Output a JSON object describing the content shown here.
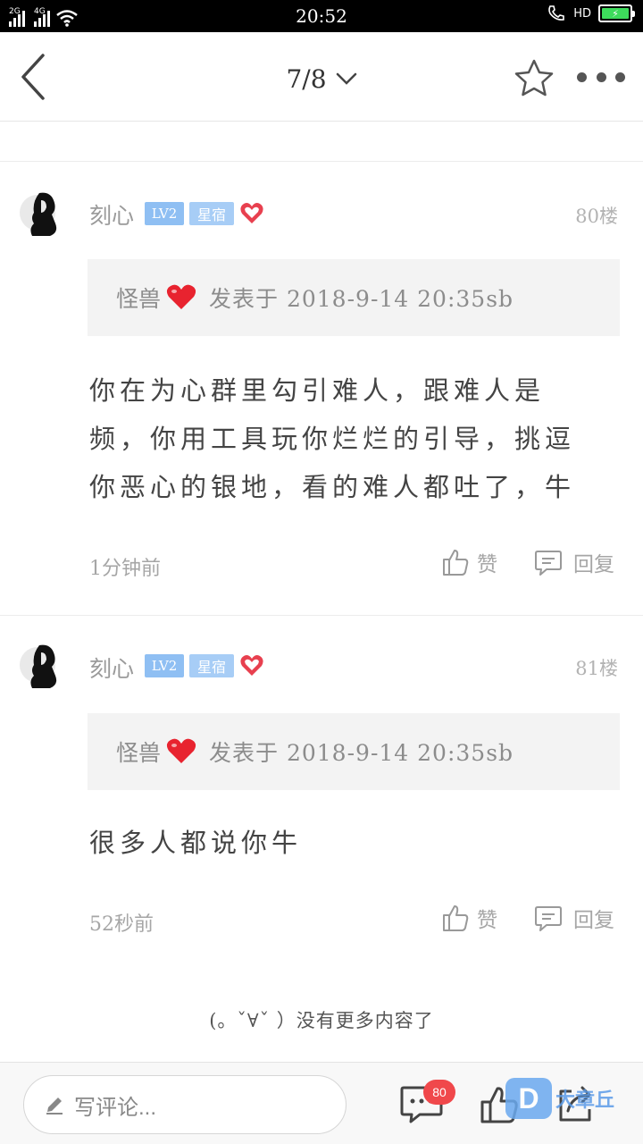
{
  "status_bar": {
    "network_1": "2G",
    "network_2": "4G",
    "time": "20:52",
    "hd": "HD",
    "battery_level": 1.0
  },
  "nav": {
    "page_indicator": "7/8"
  },
  "comments": [
    {
      "username": "刻心",
      "level": "LV2",
      "title": "星宿",
      "floor": "80楼",
      "quote_author": "怪兽",
      "quote_meta": "发表于 2018-9-14 20:35sb",
      "body": "你在为心群里勾引难人，跟难人是频，你用工具玩你烂烂的引导，挑逗你恶心的银地，看的难人都吐了，牛",
      "time_ago": "1分钟前",
      "like_label": "赞",
      "reply_label": "回复"
    },
    {
      "username": "刻心",
      "level": "LV2",
      "title": "星宿",
      "floor": "81楼",
      "quote_author": "怪兽",
      "quote_meta": "发表于 2018-9-14 20:35sb",
      "body": "很多人都说你牛",
      "time_ago": "52秒前",
      "like_label": "赞",
      "reply_label": "回复"
    }
  ],
  "end_note": "(。ˇ∀ˇ ）没有更多内容了",
  "bottom_bar": {
    "comment_placeholder": "写评论...",
    "comment_count": "80"
  },
  "watermark": {
    "logo": "D",
    "text": "大章丘"
  },
  "colors": {
    "level_badge": "#8fbff3",
    "title_badge": "#a7cdf6",
    "heart": "#e8404f",
    "count_badge": "#f0484b",
    "battery": "#3ddc5c"
  },
  "icons": [
    "back-icon",
    "chevron-down-icon",
    "star-icon",
    "more-icon",
    "heart-icon",
    "thumbs-up-icon",
    "reply-icon",
    "pencil-icon",
    "comments-icon",
    "share-icon"
  ]
}
